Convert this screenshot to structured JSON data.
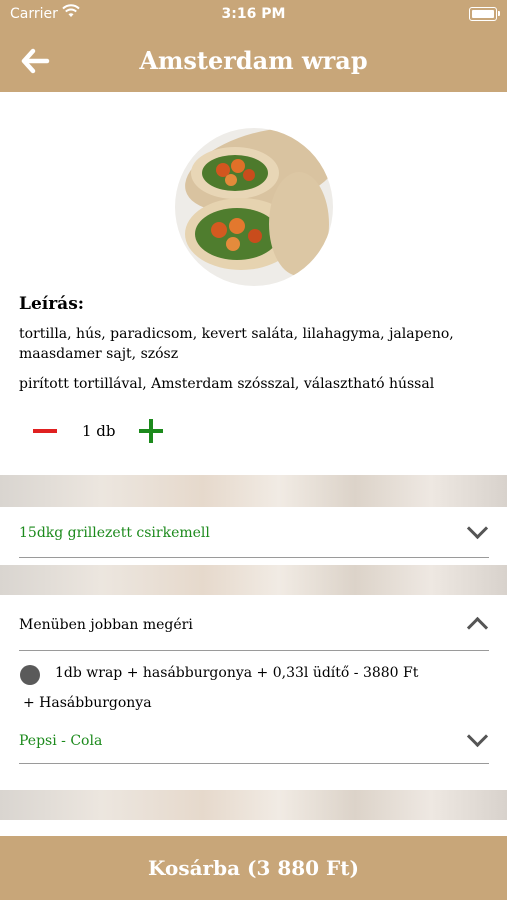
{
  "status_bar": {
    "carrier": "Carrier",
    "time": "3:16 PM"
  },
  "nav": {
    "title": "Amsterdam wrap",
    "back_icon": "back-arrow-icon"
  },
  "product": {
    "description_label": "Leírás:",
    "ingredients": "tortilla, hús, paradicsom, kevert saláta, lilahagyma, jalapeno, maasdamer sajt, szósz",
    "note": "pirított tortillával, Amsterdam szósszal, választható hússal",
    "quantity": "1 db"
  },
  "meat_select": {
    "value": "15dkg grillezett csirkemell"
  },
  "menu_section": {
    "header": "Menüben jobban megéri",
    "option": "1db wrap + hasábburgonya + 0,33l üdítő - 3880 Ft",
    "extra": "+ Hasábburgonya",
    "drink_value": "Pepsi - Cola"
  },
  "cart_button": {
    "label": "Kosárba (3 880 Ft)"
  },
  "colors": {
    "accent": "#c8a679",
    "green": "#1c8a1c",
    "red": "#e02020"
  }
}
